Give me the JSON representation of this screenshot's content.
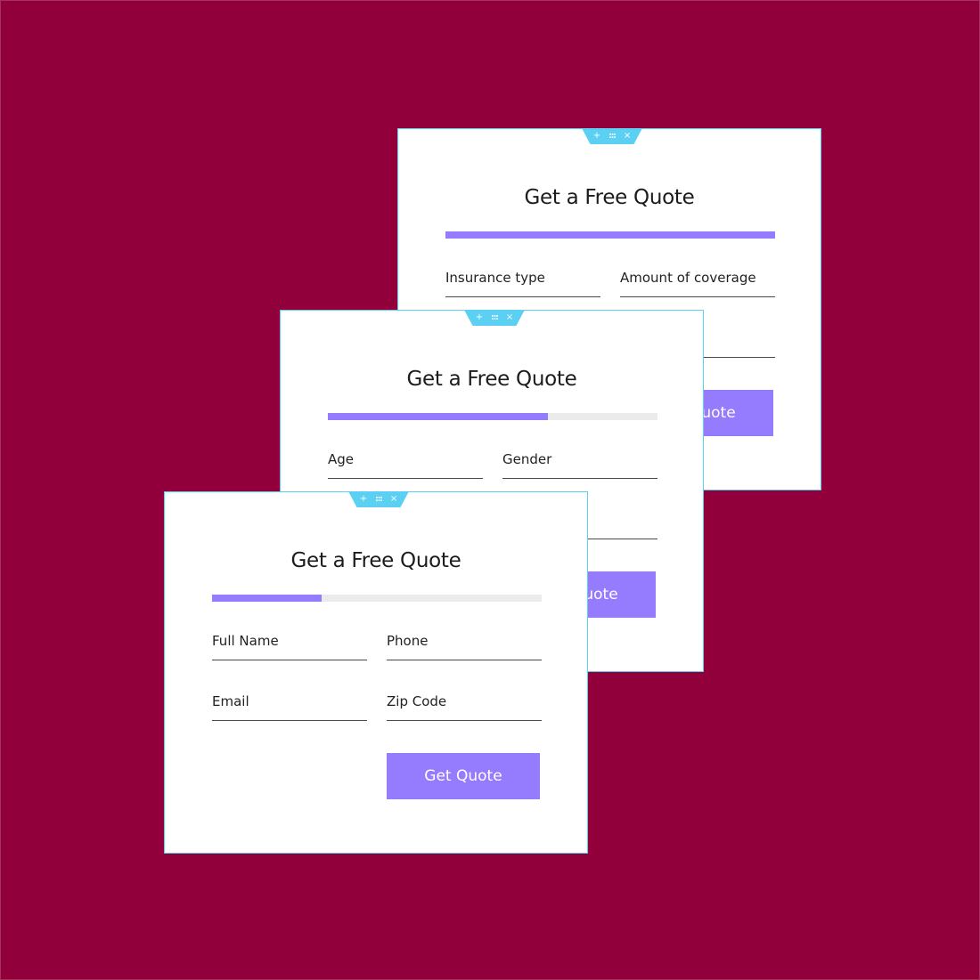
{
  "colors": {
    "background": "#92003B",
    "card_border": "#5BD0F3",
    "accent": "#957BFD",
    "progress_track": "#EBEBEB"
  },
  "toolbar": {
    "add_icon": "+",
    "grip_icon": ":::",
    "close_icon": "×"
  },
  "cards": [
    {
      "step": 3,
      "title": "Get a Free Quote",
      "progress": 1.0,
      "fields": [
        {
          "label": "Insurance type"
        },
        {
          "label": "Amount of coverage"
        },
        {
          "label": ""
        },
        {
          "label": ""
        }
      ],
      "button": "Get Quote"
    },
    {
      "step": 2,
      "title": "Get a Free Quote",
      "progress": 0.667,
      "fields": [
        {
          "label": "Age"
        },
        {
          "label": "Gender"
        },
        {
          "label": ""
        },
        {
          "label": ""
        }
      ],
      "button": "Get Quote"
    },
    {
      "step": 1,
      "title": "Get a Free Quote",
      "progress": 0.333,
      "fields": [
        {
          "label": "Full Name"
        },
        {
          "label": "Phone"
        },
        {
          "label": "Email"
        },
        {
          "label": "Zip Code"
        }
      ],
      "button": "Get Quote"
    }
  ]
}
